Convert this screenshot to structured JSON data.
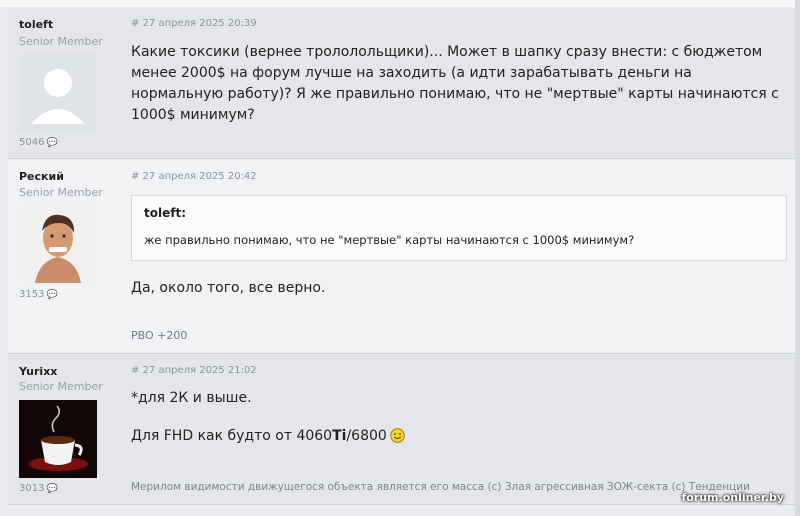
{
  "posts": [
    {
      "author": "toleft",
      "rank": "Senior Member",
      "count": "5046",
      "date": "# 27 апреля 2025 20:39",
      "text": "Какие токсики (вернее трололольщики)... Может в шапку сразу внести: с бюджетом менее 2000$ на форум лучше на заходить (а идти зарабатывать деньги на нормальную работу)? Я же правильно понимаю, что не \"мертвые\" карты начинаются с 1000$ минимум?"
    },
    {
      "author": "Реский",
      "rank": "Senior Member",
      "count": "3153",
      "date": "# 27 апреля 2025 20:42",
      "quote_author": "toleft:",
      "quote_text": "же правильно понимаю, что не \"мертвые\" карты начинаются с 1000$ минимум?",
      "text": "Да, около того, все верно.",
      "rating": "PBO +200"
    },
    {
      "author": "Yurixx",
      "rank": "Senior Member",
      "count": "3013",
      "date": "# 27 апреля 2025 21:02",
      "line1": "*для 2К и выше.",
      "line2_pre": "Для FHD как будто от 4060",
      "line2_bold": "Ti",
      "line2_post": "/6800",
      "signature": "Мерилом видимости движущегося объекта является его масса (c) Злая агрессивная ЗОЖ-секта (c) Тенденции"
    }
  ],
  "icons": {
    "message": "💬",
    "smile": "smile-emoticon-icon"
  },
  "watermark": "forum.onliner.by",
  "colors": {
    "post_bg_dark": "#e4e6ea",
    "post_bg_light": "#f1f2f4",
    "rank_gray": "#9aa0a8"
  }
}
